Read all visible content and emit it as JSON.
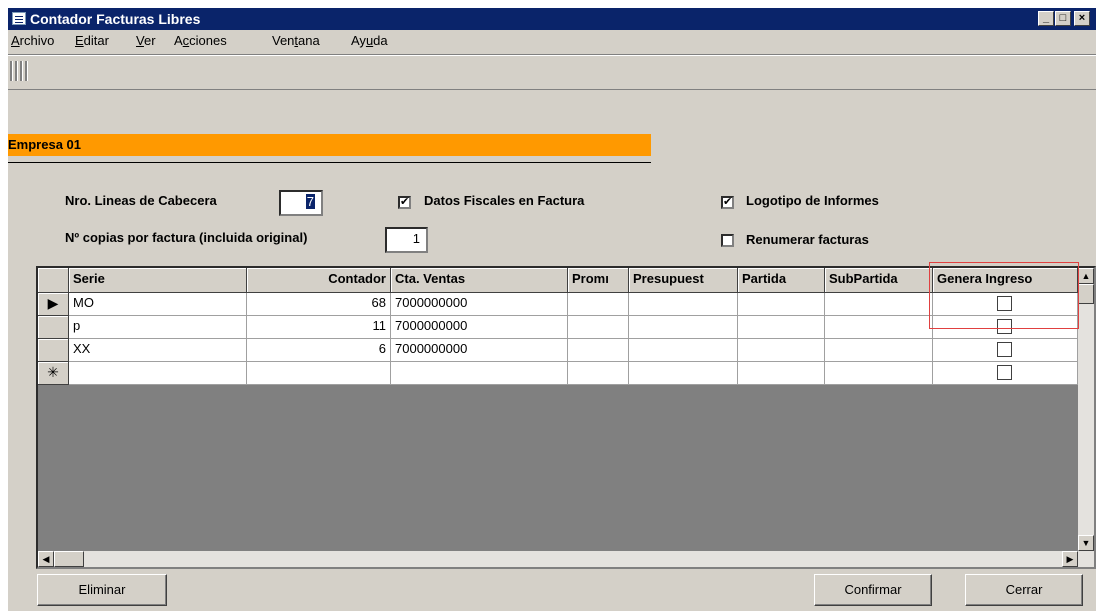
{
  "window": {
    "title": "Contador Facturas Libres",
    "controls": [
      "_",
      "□",
      "×"
    ]
  },
  "menu": [
    {
      "mnemonic": "A",
      "rest": "rchivo"
    },
    {
      "mnemonic": "E",
      "rest": "ditar"
    },
    {
      "mnemonic": "V",
      "rest": "er"
    },
    {
      "pre": "A",
      "mnemonic": "c",
      "rest": "ciones"
    },
    {
      "pre": "Ven",
      "mnemonic": "t",
      "rest": "ana"
    },
    {
      "pre": "Ay",
      "mnemonic": "u",
      "rest": "da"
    }
  ],
  "empresa": "Empresa 01",
  "form": {
    "nro_lineas_label": "Nro. Lineas de Cabecera",
    "nro_lineas_value": "7",
    "copias_label": "Nº copias por factura (incluida original)",
    "copias_value": "1",
    "datos_fiscales_label": "Datos Fiscales en Factura",
    "datos_fiscales_checked": true,
    "logotipo_label": "Logotipo de Informes",
    "logotipo_checked": true,
    "renumerar_label": "Renumerar facturas",
    "renumerar_checked": false
  },
  "grid": {
    "columns": [
      "Serie",
      "Contador",
      "Cta. Ventas",
      "Promı",
      "Presupuest",
      "Partida",
      "SubPartida",
      "Genera Ingreso"
    ],
    "rows": [
      {
        "serie": "MO",
        "contador": "68",
        "cta": "7000000000",
        "genera": false
      },
      {
        "serie": "p",
        "contador": "11",
        "cta": "7000000000",
        "genera": false
      },
      {
        "serie": "XX",
        "contador": "6",
        "cta": "7000000000",
        "genera": false
      }
    ],
    "current_row_marker": "▶",
    "new_row_marker": "✳"
  },
  "buttons": {
    "eliminar": "Eliminar",
    "confirmar": "Confirmar",
    "cerrar": "Cerrar"
  }
}
